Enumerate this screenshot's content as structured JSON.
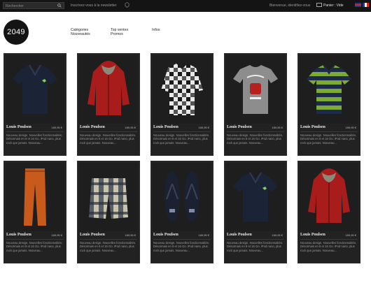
{
  "topbar": {
    "search_placeholder": "Rechercher",
    "newsletter": "Inscrivez-vous à la newsletter",
    "welcome": "Bienvenue, identifiez-vous",
    "cart": "Panier : Vide"
  },
  "logo": "2049",
  "nav": [
    [
      "Catégories",
      "Nouveautés"
    ],
    [
      "Top ventes",
      "Promos"
    ],
    [
      "Infos",
      ""
    ]
  ],
  "products": [
    {
      "name": "Louis Poulsen",
      "price": "189,95 €",
      "desc": "Nouveau design. Nouvelles fonctionnalités. Désormais en 8 et 16 Go. iPod nano, plus rock que jamais. Nouveau..."
    },
    {
      "name": "Louis Poulsen",
      "price": "189,95 €",
      "desc": "Nouveau design. Nouvelles fonctionnalités. Désormais en 8 et 16 Go. iPod nano, plus rock que jamais. Nouveau..."
    },
    {
      "name": "Louis Poulsen",
      "price": "189,95 €",
      "desc": "Nouveau design. Nouvelles fonctionnalités. Désormais en 8 et 16 Go. iPod nano, plus rock que jamais. Nouveau..."
    },
    {
      "name": "Louis Poulsen",
      "price": "189,95 €",
      "desc": "Nouveau design. Nouvelles fonctionnalités. Désormais en 8 et 16 Go. iPod nano, plus rock que jamais. Nouveau..."
    },
    {
      "name": "Louis Poulsen",
      "price": "189,95 €",
      "desc": "Nouveau design. Nouvelles fonctionnalités. Désormais en 8 et 16 Go. iPod nano, plus rock que jamais. Nouveau..."
    },
    {
      "name": "Louis Poulsen",
      "price": "189,95 €",
      "desc": "Nouveau design. Nouvelles fonctionnalités. Désormais en 8 et 16 Go. iPod nano, plus rock que jamais. Nouveau..."
    },
    {
      "name": "Louis Poulsen",
      "price": "189,95 €",
      "desc": "Nouveau design. Nouvelles fonctionnalités. Désormais en 8 et 16 Go. iPod nano, plus rock que jamais. Nouveau..."
    },
    {
      "name": "Louis Poulsen",
      "price": "189,95 €",
      "desc": "Nouveau design. Nouvelles fonctionnalités. Désormais en 8 et 16 Go. iPod nano, plus rock que jamais. Nouveau..."
    },
    {
      "name": "Louis Poulsen",
      "price": "189,95 €",
      "desc": "Nouveau design. Nouvelles fonctionnalités. Désormais en 8 et 16 Go. iPod nano, plus rock que jamais. Nouveau..."
    },
    {
      "name": "Louis Poulsen",
      "price": "189,95 €",
      "desc": "Nouveau design. Nouvelles fonctionnalités. Désormais en 8 et 16 Go. iPod nano, plus rock que jamais. Nouveau..."
    }
  ],
  "colors": {
    "topbar": "#141414",
    "card": "#222222",
    "accent": "#ffffff"
  }
}
